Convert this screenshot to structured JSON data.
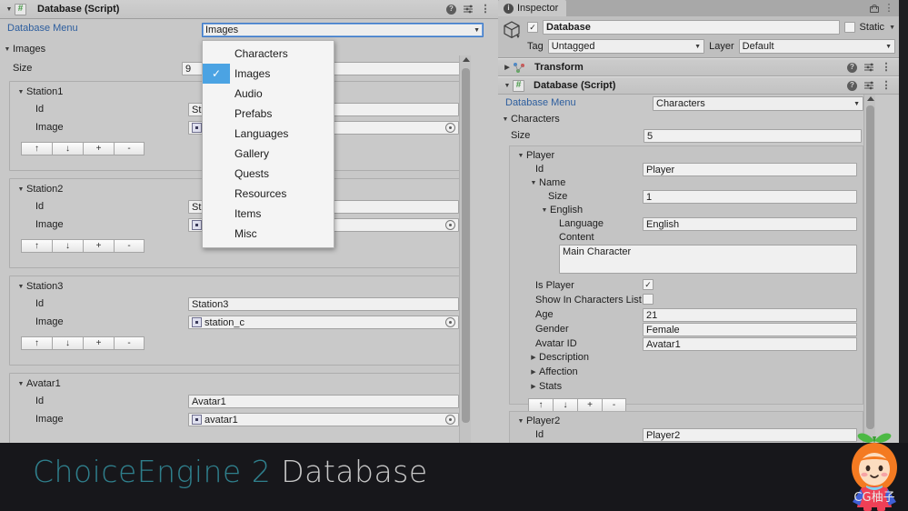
{
  "left_panel": {
    "header": {
      "title": "Database (Script)",
      "script_icon": "#",
      "icons": [
        "help-icon",
        "preset-icon",
        "more-menu-icon"
      ]
    },
    "database_menu_label": "Database Menu",
    "database_menu_value": "Images",
    "section_label": "Images",
    "size_label": "Size",
    "size_value": "9",
    "list_buttons": [
      "↑",
      "↓",
      "+",
      "-"
    ],
    "entries": [
      {
        "name": "Station1",
        "id_label": "Id",
        "id_value": "St",
        "image_label": "Image",
        "image_value": ""
      },
      {
        "name": "Station2",
        "id_label": "Id",
        "id_value": "St",
        "image_label": "Image",
        "image_value": ""
      },
      {
        "name": "Station3",
        "id_label": "Id",
        "id_value": "Station3",
        "image_label": "Image",
        "image_value": "station_c"
      },
      {
        "name": "Avatar1",
        "id_label": "Id",
        "id_value": "Avatar1",
        "image_label": "Image",
        "image_value": "avatar1"
      }
    ]
  },
  "dropdown": {
    "selected": "Images",
    "items": [
      {
        "label": "Characters",
        "checked": false
      },
      {
        "label": "Images",
        "checked": true
      },
      {
        "label": "Audio",
        "checked": false
      },
      {
        "label": "Prefabs",
        "checked": false
      },
      {
        "label": "Languages",
        "checked": false
      },
      {
        "label": "Gallery",
        "checked": false
      },
      {
        "label": "Quests",
        "checked": false
      },
      {
        "label": "Resources",
        "checked": false
      },
      {
        "label": "Items",
        "checked": false
      },
      {
        "label": "Misc",
        "checked": false
      }
    ],
    "check_glyph": "✓"
  },
  "inspector": {
    "tab_label": "Inspector",
    "gameobject": {
      "name": "Database",
      "enabled": true,
      "static_label": "Static",
      "static_checked": false,
      "tag_label": "Tag",
      "tag_value": "Untagged",
      "layer_label": "Layer",
      "layer_value": "Default"
    },
    "components": [
      {
        "name": "Transform",
        "expanded": false
      },
      {
        "name": "Database (Script)",
        "expanded": true
      }
    ],
    "database_menu_label": "Database Menu",
    "database_menu_value": "Characters",
    "section_label": "Characters",
    "size_label": "Size",
    "size_value": "5",
    "player": {
      "name": "Player",
      "id_label": "Id",
      "id_value": "Player",
      "name_group_label": "Name",
      "name_size_label": "Size",
      "name_size_value": "1",
      "english_group_label": "English",
      "language_label": "Language",
      "language_value": "English",
      "content_label": "Content",
      "content_value": "Main Character",
      "is_player_label": "Is Player",
      "is_player_checked": true,
      "show_in_list_label": "Show In Characters List",
      "show_in_list_checked": false,
      "age_label": "Age",
      "age_value": "21",
      "gender_label": "Gender",
      "gender_value": "Female",
      "avatar_id_label": "Avatar ID",
      "avatar_id_value": "Avatar1",
      "foldouts": [
        "Description",
        "Affection",
        "Stats"
      ],
      "list_buttons": [
        "↑",
        "↓",
        "+",
        "-"
      ]
    },
    "player2": {
      "name": "Player2",
      "id_label": "Id",
      "id_value": "Player2"
    }
  },
  "banner": {
    "title_accent": "ChoiceEngine 2",
    "title_rest": "Database",
    "accent_color": "#2f7f8c",
    "rest_color": "#c7c7c7",
    "watermark": "CG柚子"
  }
}
